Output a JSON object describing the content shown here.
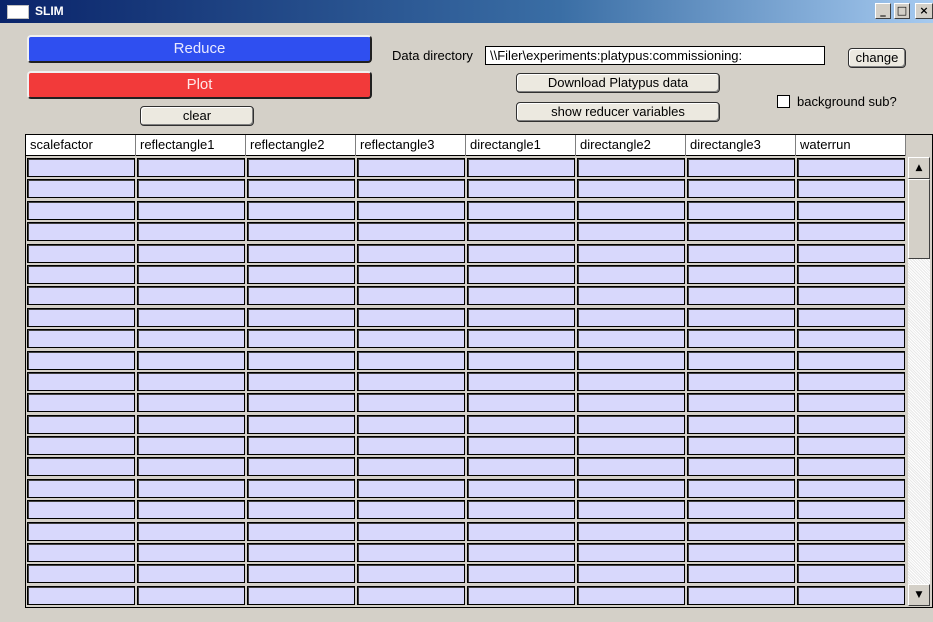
{
  "window": {
    "title": "SLIM",
    "minimize_glyph": "_",
    "maximize_glyph": "□",
    "close_glyph": "×"
  },
  "actions": {
    "reduce_label": "Reduce",
    "plot_label": "Plot",
    "clear_label": "clear",
    "download_label": "Download Platypus data",
    "show_vars_label": "show reducer variables",
    "change_label": "change"
  },
  "data_directory": {
    "label": "Data directory",
    "value": "\\\\Filer\\experiments:platypus:commissioning:"
  },
  "background_sub": {
    "label": "background sub?",
    "checked": false
  },
  "colors": {
    "reduce_button": "#2f4ff0",
    "plot_button": "#f23a3a",
    "cell_fill": "#d8d8fc"
  },
  "table": {
    "columns": [
      "scalefactor",
      "reflectangle1",
      "reflectangle2",
      "reflectangle3",
      "directangle1",
      "directangle2",
      "directangle3",
      "waterrun"
    ],
    "row_count": 21
  },
  "scrollbar": {
    "up_glyph": "▲",
    "down_glyph": "▼"
  }
}
